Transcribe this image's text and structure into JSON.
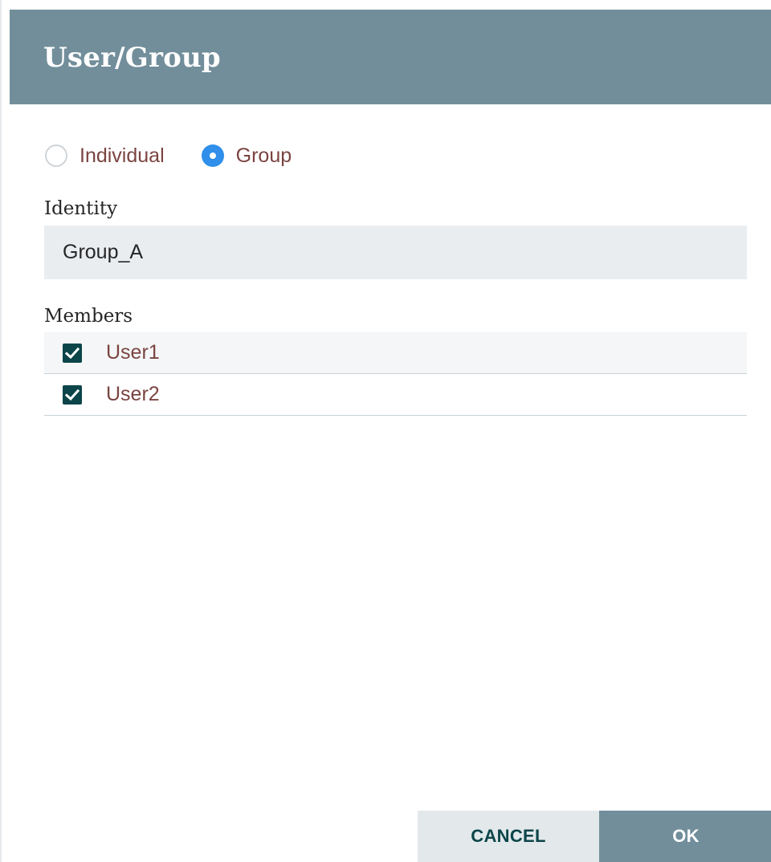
{
  "dialog": {
    "title": "User/Group"
  },
  "type_selector": {
    "options": [
      {
        "label": "Individual",
        "selected": false
      },
      {
        "label": "Group",
        "selected": true
      }
    ]
  },
  "identity": {
    "label": "Identity",
    "value": "Group_A"
  },
  "members": {
    "label": "Members",
    "items": [
      {
        "label": "User1",
        "checked": true
      },
      {
        "label": "User2",
        "checked": true
      }
    ]
  },
  "buttons": {
    "cancel_label": "CANCEL",
    "ok_label": "OK"
  },
  "colors": {
    "header": "#728e9b",
    "accent_radio": "#2f8fea",
    "checkbox": "#0c4549",
    "link_text": "#7a4441"
  }
}
